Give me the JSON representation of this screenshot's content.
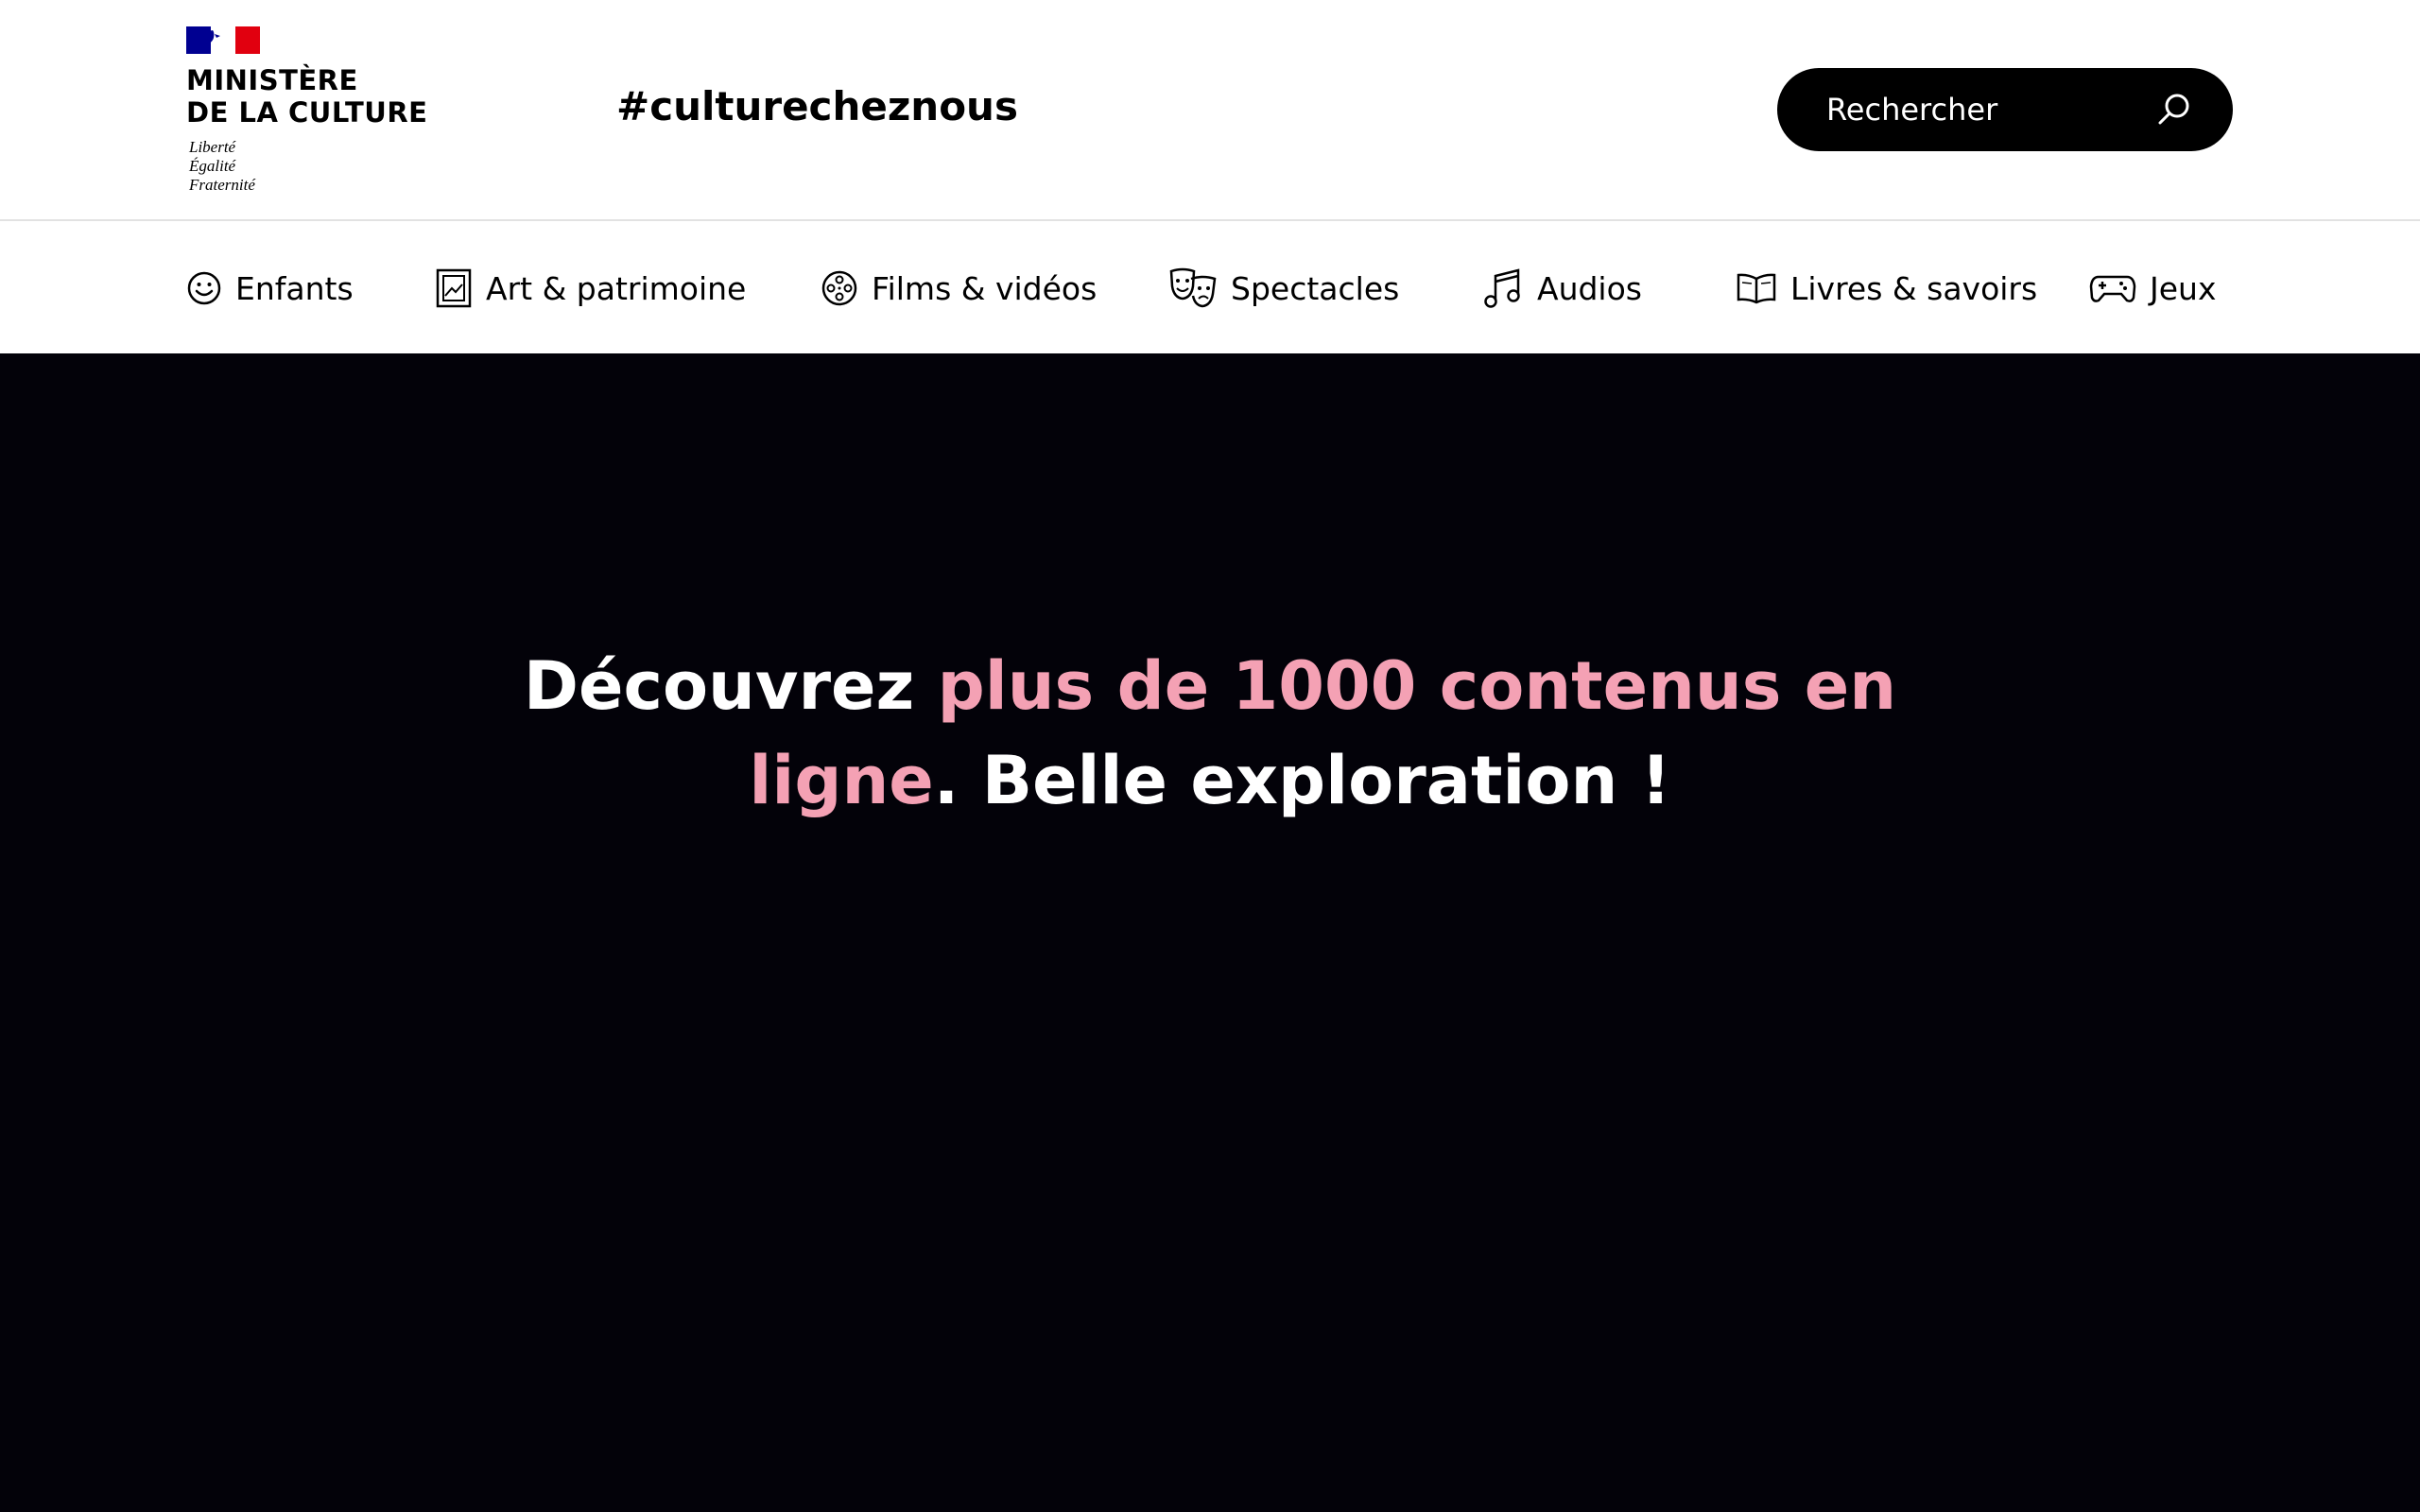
{
  "header": {
    "ministry_line1": "MINISTÈRE",
    "ministry_line2": "DE LA CULTURE",
    "motto_line1": "Liberté",
    "motto_line2": "Égalité",
    "motto_line3": "Fraternité",
    "hashtag": "#culturecheznous",
    "search_placeholder": "Rechercher"
  },
  "nav": {
    "items": [
      {
        "label": "Enfants",
        "icon": "smiley-icon"
      },
      {
        "label": "Art & patrimoine",
        "icon": "picture-frame-icon"
      },
      {
        "label": "Films & vidéos",
        "icon": "film-reel-icon"
      },
      {
        "label": "Spectacles",
        "icon": "theater-masks-icon"
      },
      {
        "label": "Audios",
        "icon": "music-note-icon"
      },
      {
        "label": "Livres & savoirs",
        "icon": "open-book-icon"
      },
      {
        "label": "Jeux",
        "icon": "gamepad-icon"
      }
    ]
  },
  "hero": {
    "title_part1": "Découvrez ",
    "title_highlight1": "plus de 1000 contenus en",
    "title_highlight2": "ligne",
    "title_part2": ". Belle exploration !"
  },
  "colors": {
    "hero_background": "#030209",
    "accent_pink": "#f4a1b4",
    "search_background": "#000000",
    "flag_blue": "#000091",
    "flag_red": "#e1000f"
  }
}
